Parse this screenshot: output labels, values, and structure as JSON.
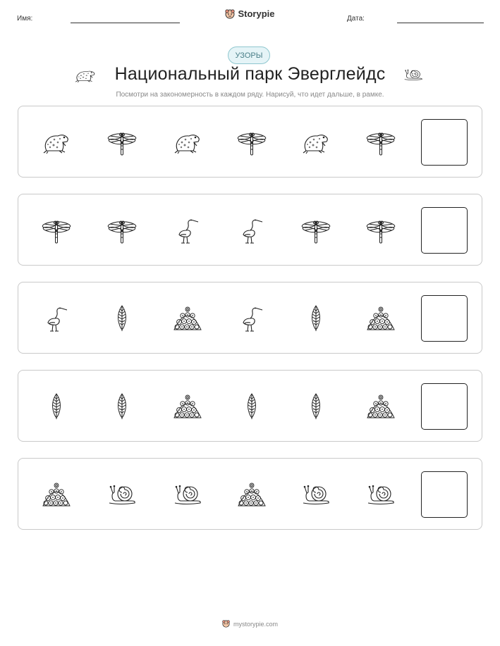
{
  "header": {
    "name_label": "Имя:",
    "date_label": "Дата:",
    "brand": "Storypie"
  },
  "tag": "УЗОРЫ",
  "title": "Национальный парк Эверглейдс",
  "instructions": "Посмотри на закономерность в каждом ряду. Нарисуй, что идет дальше, в рамке.",
  "rows": [
    [
      "frog",
      "dragonfly",
      "frog",
      "dragonfly",
      "frog",
      "dragonfly"
    ],
    [
      "dragonfly",
      "dragonfly",
      "heron",
      "heron",
      "dragonfly",
      "dragonfly"
    ],
    [
      "heron",
      "leaf",
      "shell-pile",
      "heron",
      "leaf",
      "shell-pile"
    ],
    [
      "leaf",
      "leaf",
      "shell-pile",
      "leaf",
      "leaf",
      "shell-pile"
    ],
    [
      "shell-pile",
      "snail",
      "snail",
      "shell-pile",
      "snail",
      "snail"
    ]
  ],
  "footer": {
    "site": "mystorypie.com"
  }
}
